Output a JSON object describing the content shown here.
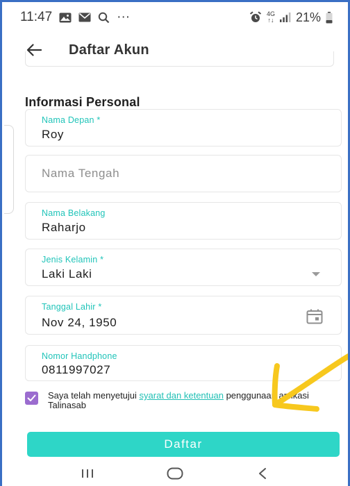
{
  "status_bar": {
    "time": "11:47",
    "ellipsis": "···",
    "network_top": "4G",
    "network_bottom": "↑↓",
    "battery_percent": "21%"
  },
  "app_bar": {
    "title": "Daftar Akun"
  },
  "section": {
    "title": "Informasi Personal"
  },
  "fields": {
    "first_name": {
      "label": "Nama Depan *",
      "value": "Roy"
    },
    "middle_name": {
      "placeholder": "Nama Tengah"
    },
    "last_name": {
      "label": "Nama Belakang",
      "value": "Raharjo"
    },
    "gender": {
      "label": "Jenis Kelamin *",
      "value": "Laki Laki"
    },
    "birth_date": {
      "label": "Tanggal Lahir *",
      "value": "Nov 24, 1950"
    },
    "phone": {
      "label": "Nomor Handphone",
      "value": "0811997027"
    }
  },
  "terms": {
    "checked": true,
    "prefix": "Saya telah menyetujui ",
    "link": "syarat dan ketentuan",
    "suffix": " penggunaan aplikasi Talinasab"
  },
  "submit": {
    "label": "Daftar"
  },
  "icons": {
    "back": "arrow-left-icon",
    "calendar": "calendar-icon",
    "dropdown": "chevron-down-icon",
    "checkbox": "check-icon"
  },
  "colors": {
    "accent_teal": "#2ed6c7",
    "label_teal": "#20c4b9",
    "checkbox_purple": "#9b6ccf",
    "annotation_yellow": "#f7c81e",
    "frame_blue": "#3a6fc4"
  }
}
